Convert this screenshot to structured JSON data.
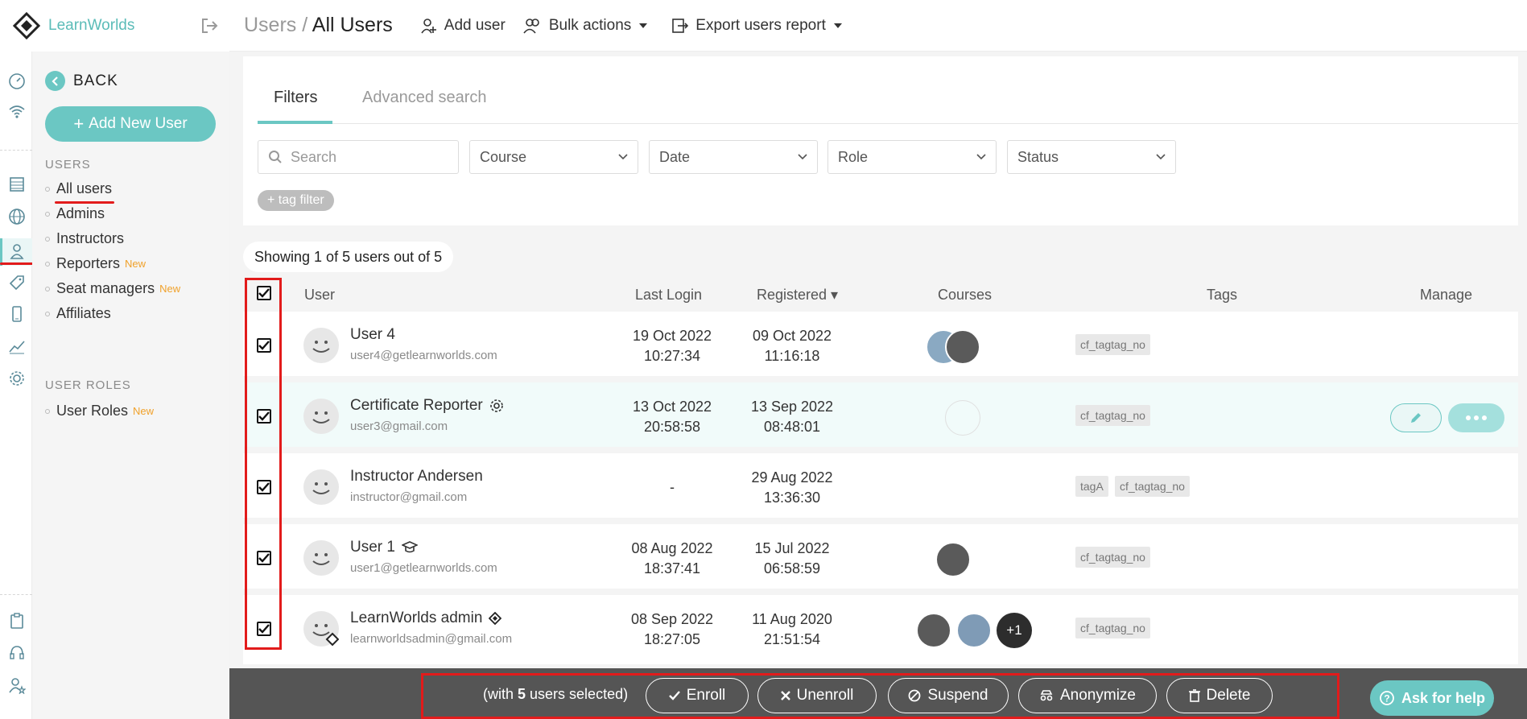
{
  "app": {
    "logo_text": "LearnWorlds"
  },
  "header": {
    "breadcrumb_parent": "Users",
    "breadcrumb_sep": " / ",
    "breadcrumb_current": "All Users",
    "add_user": "Add user",
    "bulk_actions": "Bulk actions",
    "export_report": "Export users report"
  },
  "nav": {
    "back": "BACK",
    "add_new_user": "Add New User",
    "section_users": "USERS",
    "items": [
      {
        "label": "All users",
        "new": ""
      },
      {
        "label": "Admins",
        "new": ""
      },
      {
        "label": "Instructors",
        "new": ""
      },
      {
        "label": "Reporters",
        "new": "New"
      },
      {
        "label": "Seat managers",
        "new": "New"
      },
      {
        "label": "Affiliates",
        "new": ""
      }
    ],
    "section_roles": "USER ROLES",
    "roles_items": [
      {
        "label": "User Roles",
        "new": "New"
      }
    ]
  },
  "filters": {
    "tab_active": "Filters",
    "tab_inactive": "Advanced search",
    "search_placeholder": "Search",
    "course": "Course",
    "date": "Date",
    "role": "Role",
    "status": "Status",
    "tag_filter": "+ tag filter"
  },
  "showing": "Showing 1 of 5 users out of 5",
  "table": {
    "headers": {
      "user": "User",
      "last_login": "Last Login",
      "registered": "Registered ▾",
      "courses": "Courses",
      "tags": "Tags",
      "manage": "Manage"
    },
    "rows": [
      {
        "name": "User 4",
        "email": "user4@getlearnworlds.com",
        "login_date": "19 Oct 2022",
        "login_time": "10:27:34",
        "reg_date": "09 Oct 2022",
        "reg_time": "11:16:18",
        "tags": [
          "cf_tagtag_no"
        ],
        "badge": ""
      },
      {
        "name": "Certificate Reporter",
        "email": "user3@gmail.com",
        "login_date": "13 Oct 2022",
        "login_time": "20:58:58",
        "reg_date": "13 Sep 2022",
        "reg_time": "08:48:01",
        "tags": [
          "cf_tagtag_no"
        ],
        "badge": "gear-badge"
      },
      {
        "name": "Instructor Andersen",
        "email": "instructor@gmail.com",
        "login_date": "-",
        "login_time": "",
        "reg_date": "29 Aug 2022",
        "reg_time": "13:36:30",
        "tags": [
          "tagA",
          "cf_tagtag_no"
        ],
        "badge": ""
      },
      {
        "name": "User 1",
        "email": "user1@getlearnworlds.com",
        "login_date": "08 Aug 2022",
        "login_time": "18:37:41",
        "reg_date": "15 Jul 2022",
        "reg_time": "06:58:59",
        "tags": [
          "cf_tagtag_no"
        ],
        "badge": "graduation-cap"
      },
      {
        "name": "LearnWorlds admin",
        "email": "learnworldsadmin@gmail.com",
        "login_date": "08 Sep 2022",
        "login_time": "18:27:05",
        "reg_date": "11 Aug 2020",
        "reg_time": "21:51:54",
        "tags": [
          "cf_tagtag_no"
        ],
        "badge": "diamond-logo",
        "courses_more": "+1"
      }
    ]
  },
  "bulk": {
    "selected_prefix": "(with ",
    "selected_count": "5",
    "selected_suffix": " users selected)",
    "enroll": "Enroll",
    "unenroll": "Unenroll",
    "suspend": "Suspend",
    "anonymize": "Anonymize",
    "delete": "Delete"
  },
  "help": "Ask for help",
  "colors": {
    "accent": "#6bc7c3",
    "annotation_red": "#e21b1b",
    "new_badge": "#f0a12a",
    "bulk_bar": "#555555"
  }
}
